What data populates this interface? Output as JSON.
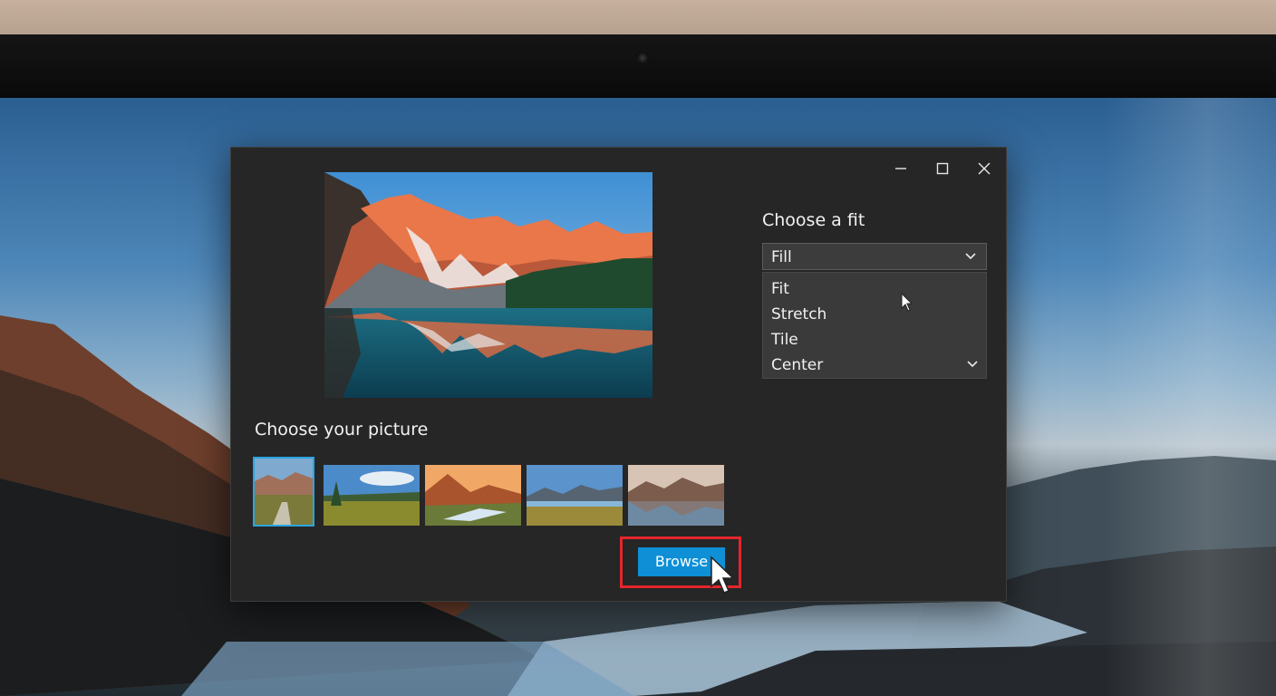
{
  "window": {
    "controls": {
      "minimize_icon": "minimize-icon",
      "maximize_icon": "maximize-icon",
      "close_icon": "close-icon"
    }
  },
  "preview": {
    "image": "mountain-lake-sunrise"
  },
  "picture_section": {
    "heading": "Choose your picture",
    "thumbnails": [
      {
        "image": "valley-road",
        "selected": true
      },
      {
        "image": "meadow-trees",
        "selected": false
      },
      {
        "image": "sunset-river",
        "selected": false
      },
      {
        "image": "mountain-lake-field",
        "selected": false
      },
      {
        "image": "lake-reflection-mountains",
        "selected": false
      }
    ]
  },
  "fit_section": {
    "heading": "Choose a fit",
    "selected": "Fill",
    "options": [
      "Fit",
      "Stretch",
      "Tile",
      "Center"
    ]
  },
  "browse": {
    "label": "Browse"
  },
  "colors": {
    "accent": "#0e8fd6",
    "highlight": "#e4262c",
    "selection": "#2aa5e0",
    "window_bg": "#262626"
  }
}
